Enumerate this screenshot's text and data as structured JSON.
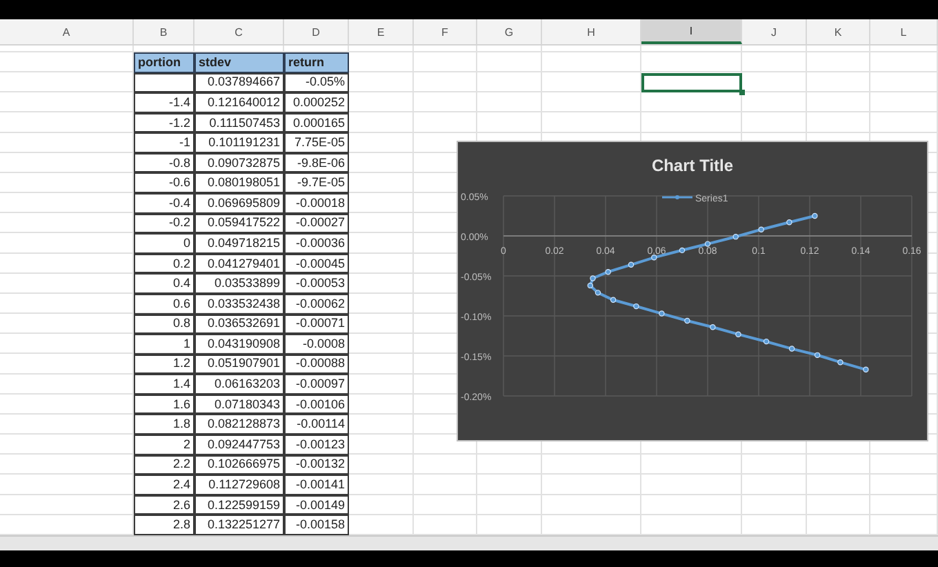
{
  "columns": [
    {
      "label": "A",
      "selected": false
    },
    {
      "label": "B",
      "selected": false
    },
    {
      "label": "C",
      "selected": false
    },
    {
      "label": "D",
      "selected": false
    },
    {
      "label": "E",
      "selected": false
    },
    {
      "label": "F",
      "selected": false
    },
    {
      "label": "G",
      "selected": false
    },
    {
      "label": "H",
      "selected": false
    },
    {
      "label": "I",
      "selected": true
    },
    {
      "label": "J",
      "selected": false
    },
    {
      "label": "K",
      "selected": false
    },
    {
      "label": "L",
      "selected": false
    }
  ],
  "table": {
    "columns": [
      "portion",
      "stdev",
      "return"
    ],
    "rows": [
      {
        "stdev": "0.037894667",
        "return": "-0.05%"
      },
      {
        "portion": "-1.4",
        "stdev": "0.121640012",
        "return": "0.000252"
      },
      {
        "portion": "-1.2",
        "stdev": "0.111507453",
        "return": "0.000165"
      },
      {
        "portion": "-1",
        "stdev": "0.101191231",
        "return": "7.75E-05"
      },
      {
        "portion": "-0.8",
        "stdev": "0.090732875",
        "return": "-9.8E-06"
      },
      {
        "portion": "-0.6",
        "stdev": "0.080198051",
        "return": "-9.7E-05"
      },
      {
        "portion": "-0.4",
        "stdev": "0.069695809",
        "return": "-0.00018"
      },
      {
        "portion": "-0.2",
        "stdev": "0.059417522",
        "return": "-0.00027"
      },
      {
        "portion": "0",
        "stdev": "0.049718215",
        "return": "-0.00036"
      },
      {
        "portion": "0.2",
        "stdev": "0.041279401",
        "return": "-0.00045"
      },
      {
        "portion": "0.4",
        "stdev": "0.03533899",
        "return": "-0.00053"
      },
      {
        "portion": "0.6",
        "stdev": "0.033532438",
        "return": "-0.00062"
      },
      {
        "portion": "0.8",
        "stdev": "0.036532691",
        "return": "-0.00071"
      },
      {
        "portion": "1",
        "stdev": "0.043190908",
        "return": "-0.0008"
      },
      {
        "portion": "1.2",
        "stdev": "0.051907901",
        "return": "-0.00088"
      },
      {
        "portion": "1.4",
        "stdev": "0.06163203",
        "return": "-0.00097"
      },
      {
        "portion": "1.6",
        "stdev": "0.07180343",
        "return": "-0.00106"
      },
      {
        "portion": "1.8",
        "stdev": "0.082128873",
        "return": "-0.00114"
      },
      {
        "portion": "2",
        "stdev": "0.092447753",
        "return": "-0.00123"
      },
      {
        "portion": "2.2",
        "stdev": "0.102666975",
        "return": "-0.00132"
      },
      {
        "portion": "2.4",
        "stdev": "0.112729608",
        "return": "-0.00141"
      },
      {
        "portion": "2.6",
        "stdev": "0.122599159",
        "return": "-0.00149"
      },
      {
        "portion": "2.8",
        "stdev": "0.132251277",
        "return": "-0.00158"
      }
    ]
  },
  "chart": {
    "chart_data": {
      "type": "line",
      "title": "Chart Title",
      "grid": true,
      "x": [
        0.122,
        0.112,
        0.101,
        0.091,
        0.08,
        0.07,
        0.059,
        0.05,
        0.041,
        0.035,
        0.034,
        0.037,
        0.043,
        0.052,
        0.062,
        0.072,
        0.082,
        0.092,
        0.103,
        0.113,
        0.123,
        0.132,
        0.142
      ],
      "series": [
        {
          "name": "Series1",
          "color": "#5b9bd5",
          "marker": "circle",
          "values": [
            0.00025,
            0.00017,
            8e-05,
            -1e-05,
            -0.0001,
            -0.00018,
            -0.00027,
            -0.00036,
            -0.00045,
            -0.00053,
            -0.00062,
            -0.00071,
            -0.0008,
            -0.00088,
            -0.00097,
            -0.00106,
            -0.00114,
            -0.00123,
            -0.00132,
            -0.00141,
            -0.00149,
            -0.00158,
            -0.00167
          ]
        }
      ],
      "xlim": [
        0,
        0.16
      ],
      "ylim": [
        -0.002,
        0.0005
      ],
      "xticks": [
        {
          "value": 0,
          "label": "0"
        },
        {
          "value": 0.02,
          "label": "0.02"
        },
        {
          "value": 0.04,
          "label": "0.04"
        },
        {
          "value": 0.06,
          "label": "0.06"
        },
        {
          "value": 0.08,
          "label": "0.08"
        },
        {
          "value": 0.1,
          "label": "0.1"
        },
        {
          "value": 0.12,
          "label": "0.12"
        },
        {
          "value": 0.14,
          "label": "0.14"
        },
        {
          "value": 0.16,
          "label": "0.16"
        }
      ],
      "yticks": [
        {
          "value": 0.0005,
          "label": "0.05%"
        },
        {
          "value": 0,
          "label": "0.00%"
        },
        {
          "value": -0.0005,
          "label": "-0.05%"
        },
        {
          "value": -0.001,
          "label": "-0.10%"
        },
        {
          "value": -0.0015,
          "label": "-0.15%"
        },
        {
          "value": -0.002,
          "label": "-0.20%"
        }
      ]
    }
  }
}
